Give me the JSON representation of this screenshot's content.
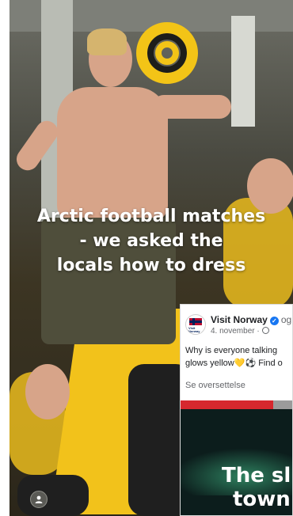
{
  "video": {
    "headline_lines": [
      "Arctic football matches",
      "- we asked the",
      "locals how to dress"
    ],
    "profile_icon": "person-icon"
  },
  "post": {
    "avatar_text": "Visit Norway",
    "page_name": "Visit Norway",
    "verified_icon": "verified-badge-icon",
    "follow_text": "og",
    "date": "4. november ·",
    "privacy_icon": "globe-icon",
    "text_lines": [
      "Why is everyone talking",
      "glows yellow💛⚽ Find o"
    ],
    "translate_link": "Se oversettelse",
    "thumbnail_text_lines": [
      "The sl",
      "town"
    ]
  },
  "colors": {
    "accent_yellow": "#f3c417",
    "verified_blue": "#1877f2",
    "thumb_red": "#d6282e"
  }
}
